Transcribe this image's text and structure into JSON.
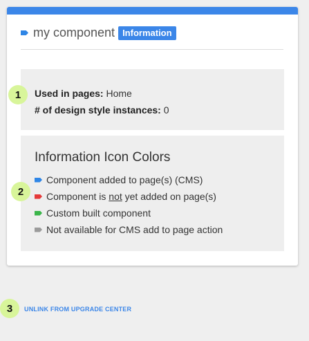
{
  "header": {
    "title": "my component",
    "badge": "Information"
  },
  "usage": {
    "used_in_pages_label": "Used in pages:",
    "used_in_pages_value": "Home",
    "instances_label": "# of design style instances:",
    "instances_value": "0"
  },
  "legend": {
    "heading": "Information Icon Colors",
    "items": [
      {
        "color": "#2f86e6",
        "icon": "blue-tag-icon",
        "text": "Component added to page(s) (CMS)"
      },
      {
        "color": "#e53a3a",
        "icon": "red-tag-icon",
        "text_before": "Component is ",
        "text_underlined": "not",
        "text_after": " yet added on page(s)"
      },
      {
        "color": "#3bb54a",
        "icon": "green-tag-icon",
        "text": "Custom built component"
      },
      {
        "color": "#9b9b9b",
        "icon": "grey-tag-icon",
        "text": "Not available for CMS add to page action"
      }
    ]
  },
  "steps": [
    "1",
    "2",
    "3"
  ],
  "footer": {
    "unlink_label": "UNLINK FROM UPGRADE CENTER"
  },
  "colors": {
    "accent": "#3b86e8",
    "step_badge": "#d8f59a"
  }
}
